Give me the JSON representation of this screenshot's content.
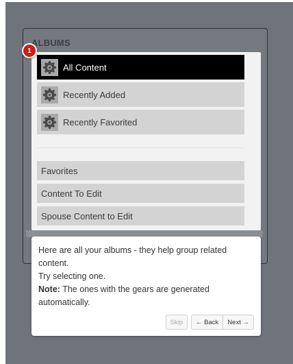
{
  "albums": {
    "title": "ALBUMS"
  },
  "menu": {
    "generated_items": [
      {
        "label": "All Content",
        "icon": "gear-icon",
        "active": true
      },
      {
        "label": "Recently Added",
        "icon": "gear-icon",
        "active": false
      },
      {
        "label": "Recently Favorited",
        "icon": "gear-icon",
        "active": false
      }
    ],
    "user_items": [
      {
        "label": "Favorites"
      },
      {
        "label": "Content To Edit"
      },
      {
        "label": "Spouse Content to Edit"
      }
    ]
  },
  "tour": {
    "step_number": "1",
    "line1": "Here are all your albums - they help group related content.",
    "line2": "Try selecting one.",
    "note_label": "Note:",
    "note_text": " The ones with the gears are generated automatically.",
    "skip_label": "Skip",
    "back_label": "← Back",
    "next_label": "Next →"
  },
  "colors": {
    "backdrop": "#6f747b",
    "active_item": "#000000",
    "item": "#d3d3d3",
    "badge": "#cc1e14"
  }
}
